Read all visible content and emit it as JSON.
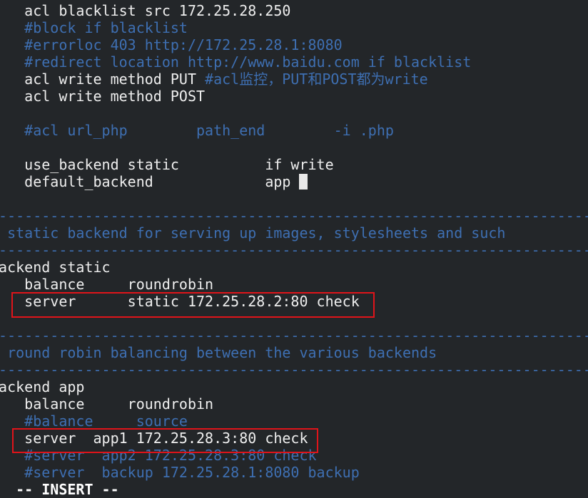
{
  "editor": {
    "mode": "vim",
    "colors": {
      "background": "#232629",
      "text": "#eeeeee",
      "comment": "#3e6fb2",
      "highlight_box": "#e0141a"
    },
    "cursor_line": 10,
    "lines": [
      [
        {
          "t": "    acl blacklist src 172.25.28.250",
          "c": "n"
        }
      ],
      [
        {
          "t": "    #block if blacklist",
          "c": "c"
        }
      ],
      [
        {
          "t": "    #errorloc 403 http://172.25.28.1:8080",
          "c": "c"
        }
      ],
      [
        {
          "t": "    #redirect location http://www.baidu.com if blacklist",
          "c": "c"
        }
      ],
      [
        {
          "t": "    acl write method PUT ",
          "c": "n"
        },
        {
          "t": "#acl监控，PUT和POST都为write",
          "c": "c"
        }
      ],
      [
        {
          "t": "    acl write method POST",
          "c": "n"
        }
      ],
      [],
      [
        {
          "t": "    #acl url_php        path_end        -i .php",
          "c": "c"
        }
      ],
      [],
      [
        {
          "t": "    use_backend static          if write",
          "c": "n"
        }
      ],
      [
        {
          "t": "    default_backend             app ",
          "c": "n"
        }
      ],
      [],
      [
        {
          "t": "#----------------------------------------------------------------------",
          "c": "c"
        }
      ],
      [
        {
          "t": "# static backend for serving up images, stylesheets and such",
          "c": "c"
        }
      ],
      [
        {
          "t": "#----------------------------------------------------------------------",
          "c": "c"
        }
      ],
      [
        {
          "t": "backend static",
          "c": "n"
        }
      ],
      [
        {
          "t": "    balance     roundrobin",
          "c": "n"
        }
      ],
      [
        {
          "t": "    server      static 172.25.28.2:80 check",
          "c": "n"
        }
      ],
      [],
      [
        {
          "t": "#----------------------------------------------------------------------",
          "c": "c"
        }
      ],
      [
        {
          "t": "# round robin balancing between the various backends",
          "c": "c"
        }
      ],
      [
        {
          "t": "#----------------------------------------------------------------------",
          "c": "c"
        }
      ],
      [
        {
          "t": "backend app",
          "c": "n"
        }
      ],
      [
        {
          "t": "    balance     roundrobin",
          "c": "n"
        }
      ],
      [
        {
          "t": "    #balance     source",
          "c": "c"
        }
      ],
      [
        {
          "t": "    server  app1 172.25.28.3:80 check",
          "c": "n"
        }
      ],
      [
        {
          "t": "    #server  app2 172.25.28.3:80 check",
          "c": "c"
        }
      ],
      [
        {
          "t": "    #server  backup 172.25.28.1:8080 backup",
          "c": "c"
        }
      ]
    ],
    "status_line": "   -- INSERT --"
  }
}
